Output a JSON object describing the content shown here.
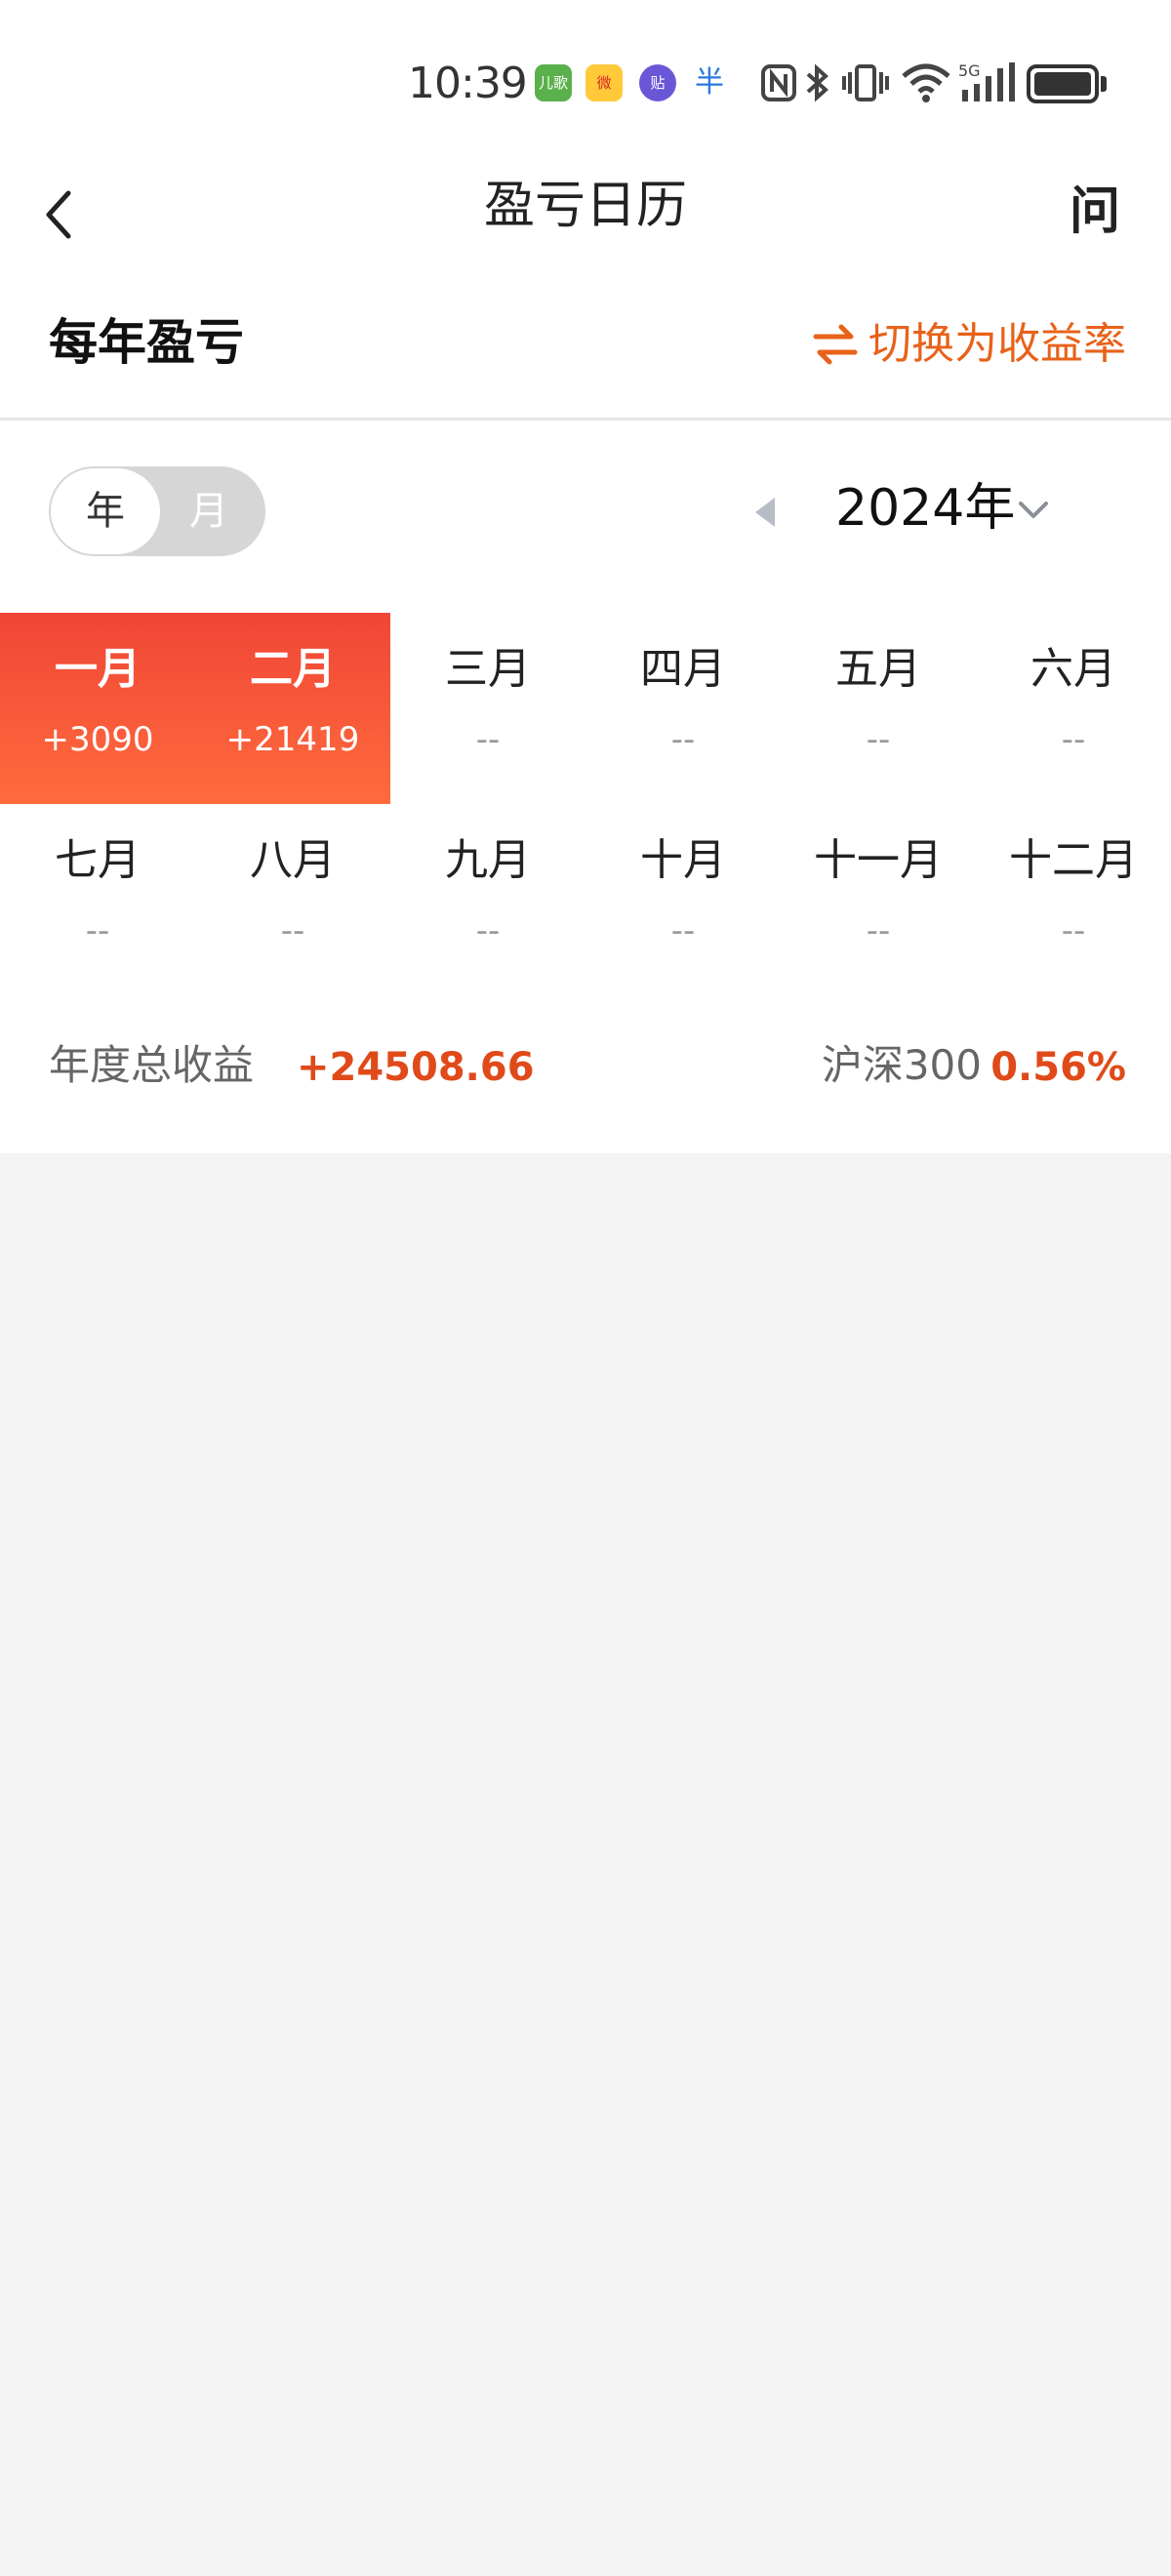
{
  "status_bar": {
    "time": "10:39",
    "app_icons": [
      "儿歌",
      "微",
      "贴",
      "半"
    ],
    "icons": [
      "nfc-icon",
      "bluetooth-icon",
      "vibrate-icon",
      "wifi-icon",
      "signal-5g-icon",
      "battery-icon"
    ]
  },
  "header": {
    "title": "盈亏日历",
    "help_label": "问",
    "back_icon": "chevron-left-icon"
  },
  "section": {
    "title": "每年盈亏",
    "switch_label": "切换为收益率",
    "switch_icon": "swap-arrows-icon"
  },
  "toggle": {
    "options": [
      "年",
      "月"
    ],
    "selected": "年"
  },
  "year_selector": {
    "year": "2024年"
  },
  "months": [
    {
      "name": "一月",
      "value": "+3090",
      "profit": true
    },
    {
      "name": "二月",
      "value": "+21419",
      "profit": true
    },
    {
      "name": "三月",
      "value": "--",
      "profit": false
    },
    {
      "name": "四月",
      "value": "--",
      "profit": false
    },
    {
      "name": "五月",
      "value": "--",
      "profit": false
    },
    {
      "name": "六月",
      "value": "--",
      "profit": false
    },
    {
      "name": "七月",
      "value": "--",
      "profit": false
    },
    {
      "name": "八月",
      "value": "--",
      "profit": false
    },
    {
      "name": "九月",
      "value": "--",
      "profit": false
    },
    {
      "name": "十月",
      "value": "--",
      "profit": false
    },
    {
      "name": "十一月",
      "value": "--",
      "profit": false
    },
    {
      "name": "十二月",
      "value": "--",
      "profit": false
    }
  ],
  "summary": {
    "total_label": "年度总收益",
    "total_value": "+24508.66",
    "benchmark_label": "沪深300",
    "benchmark_value": "0.56%"
  },
  "colors": {
    "accent": "#e8621a",
    "profit_red": "#f04636",
    "profit_orange": "#ff6b3d",
    "value_red": "#e04a1a"
  }
}
